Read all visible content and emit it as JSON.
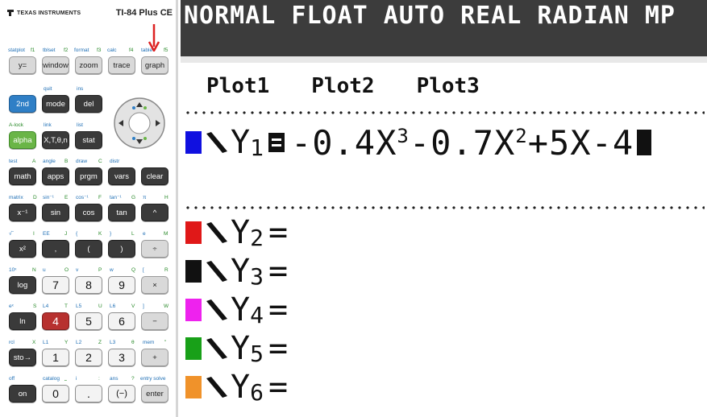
{
  "calculator": {
    "brand": "TEXAS INSTRUMENTS",
    "model": "TI-84 Plus CE",
    "rows": [
      {
        "labels": [
          [
            "statplot",
            "f1",
            "tblset",
            "f2",
            "format",
            "f3",
            "calc",
            "f4",
            "table",
            "f5"
          ]
        ],
        "keys": [
          "y=",
          "window",
          "zoom",
          "trace",
          "graph"
        ]
      },
      {
        "labels": [
          [
            "quit",
            "ins"
          ]
        ],
        "keys": [
          "2nd",
          "mode",
          "del"
        ]
      },
      {
        "labels": [
          [
            "A-lock",
            "link",
            "list"
          ]
        ],
        "keys": [
          "alpha",
          "X,T,θ,n",
          "stat"
        ]
      },
      {
        "labels": [
          [
            "test",
            "A",
            "angle",
            "B",
            "draw",
            "C",
            "distr"
          ]
        ],
        "keys": [
          "math",
          "apps",
          "prgm",
          "vars",
          "clear"
        ]
      },
      {
        "labels": [
          [
            "matrix",
            "D",
            "sin⁻¹",
            "E",
            "cos⁻¹",
            "F",
            "tan⁻¹",
            "G",
            "π",
            "H"
          ]
        ],
        "keys": [
          "x⁻¹",
          "sin",
          "cos",
          "tan",
          "^"
        ]
      },
      {
        "labels": [
          [
            "√‾",
            "I",
            "EE",
            "J",
            "{",
            "K",
            "}",
            "L",
            "e",
            "M"
          ]
        ],
        "keys": [
          "x²",
          ",",
          "(",
          ")",
          "÷"
        ]
      },
      {
        "labels": [
          [
            "10ˣ",
            "N",
            "u",
            "O",
            "v",
            "P",
            "w",
            "Q",
            "[",
            "R"
          ]
        ],
        "keys": [
          "log",
          "7",
          "8",
          "9",
          "×"
        ]
      },
      {
        "labels": [
          [
            "eˣ",
            "S",
            "L4",
            "T",
            "L5",
            "U",
            "L6",
            "V",
            "]",
            "W"
          ]
        ],
        "keys": [
          "ln",
          "4",
          "5",
          "6",
          "−"
        ]
      },
      {
        "labels": [
          [
            "rcl",
            "X",
            "L1",
            "Y",
            "L2",
            "Z",
            "L3",
            "θ",
            "mem",
            "\""
          ]
        ],
        "keys": [
          "sto→",
          "1",
          "2",
          "3",
          "+"
        ]
      },
      {
        "labels": [
          [
            "off",
            "catalog",
            "⎵",
            "i",
            ":",
            "ans",
            "?",
            "entry solve"
          ]
        ],
        "keys": [
          "on",
          "0",
          ".",
          "(−)",
          "enter"
        ]
      }
    ]
  },
  "screen": {
    "status_bar": "NORMAL FLOAT AUTO REAL RADIAN MP",
    "plots": [
      "Plot1",
      "Plot2",
      "Plot3"
    ],
    "functions": [
      {
        "name": "Y",
        "sub": "1",
        "color": "#1010e0",
        "expr_a": "-0.4X",
        "pow_a": "3",
        "expr_b": "-0.7X",
        "pow_b": "2",
        "expr_c": "+5X-4",
        "selected": true
      },
      {
        "name": "Y",
        "sub": "2",
        "color": "#e01818",
        "eq": "="
      },
      {
        "name": "Y",
        "sub": "3",
        "color": "#111111",
        "eq": "="
      },
      {
        "name": "Y",
        "sub": "4",
        "color": "#ee22ee",
        "eq": "="
      },
      {
        "name": "Y",
        "sub": "5",
        "color": "#18a018",
        "eq": "="
      },
      {
        "name": "Y",
        "sub": "6",
        "color": "#f0922a",
        "eq": "="
      }
    ]
  }
}
